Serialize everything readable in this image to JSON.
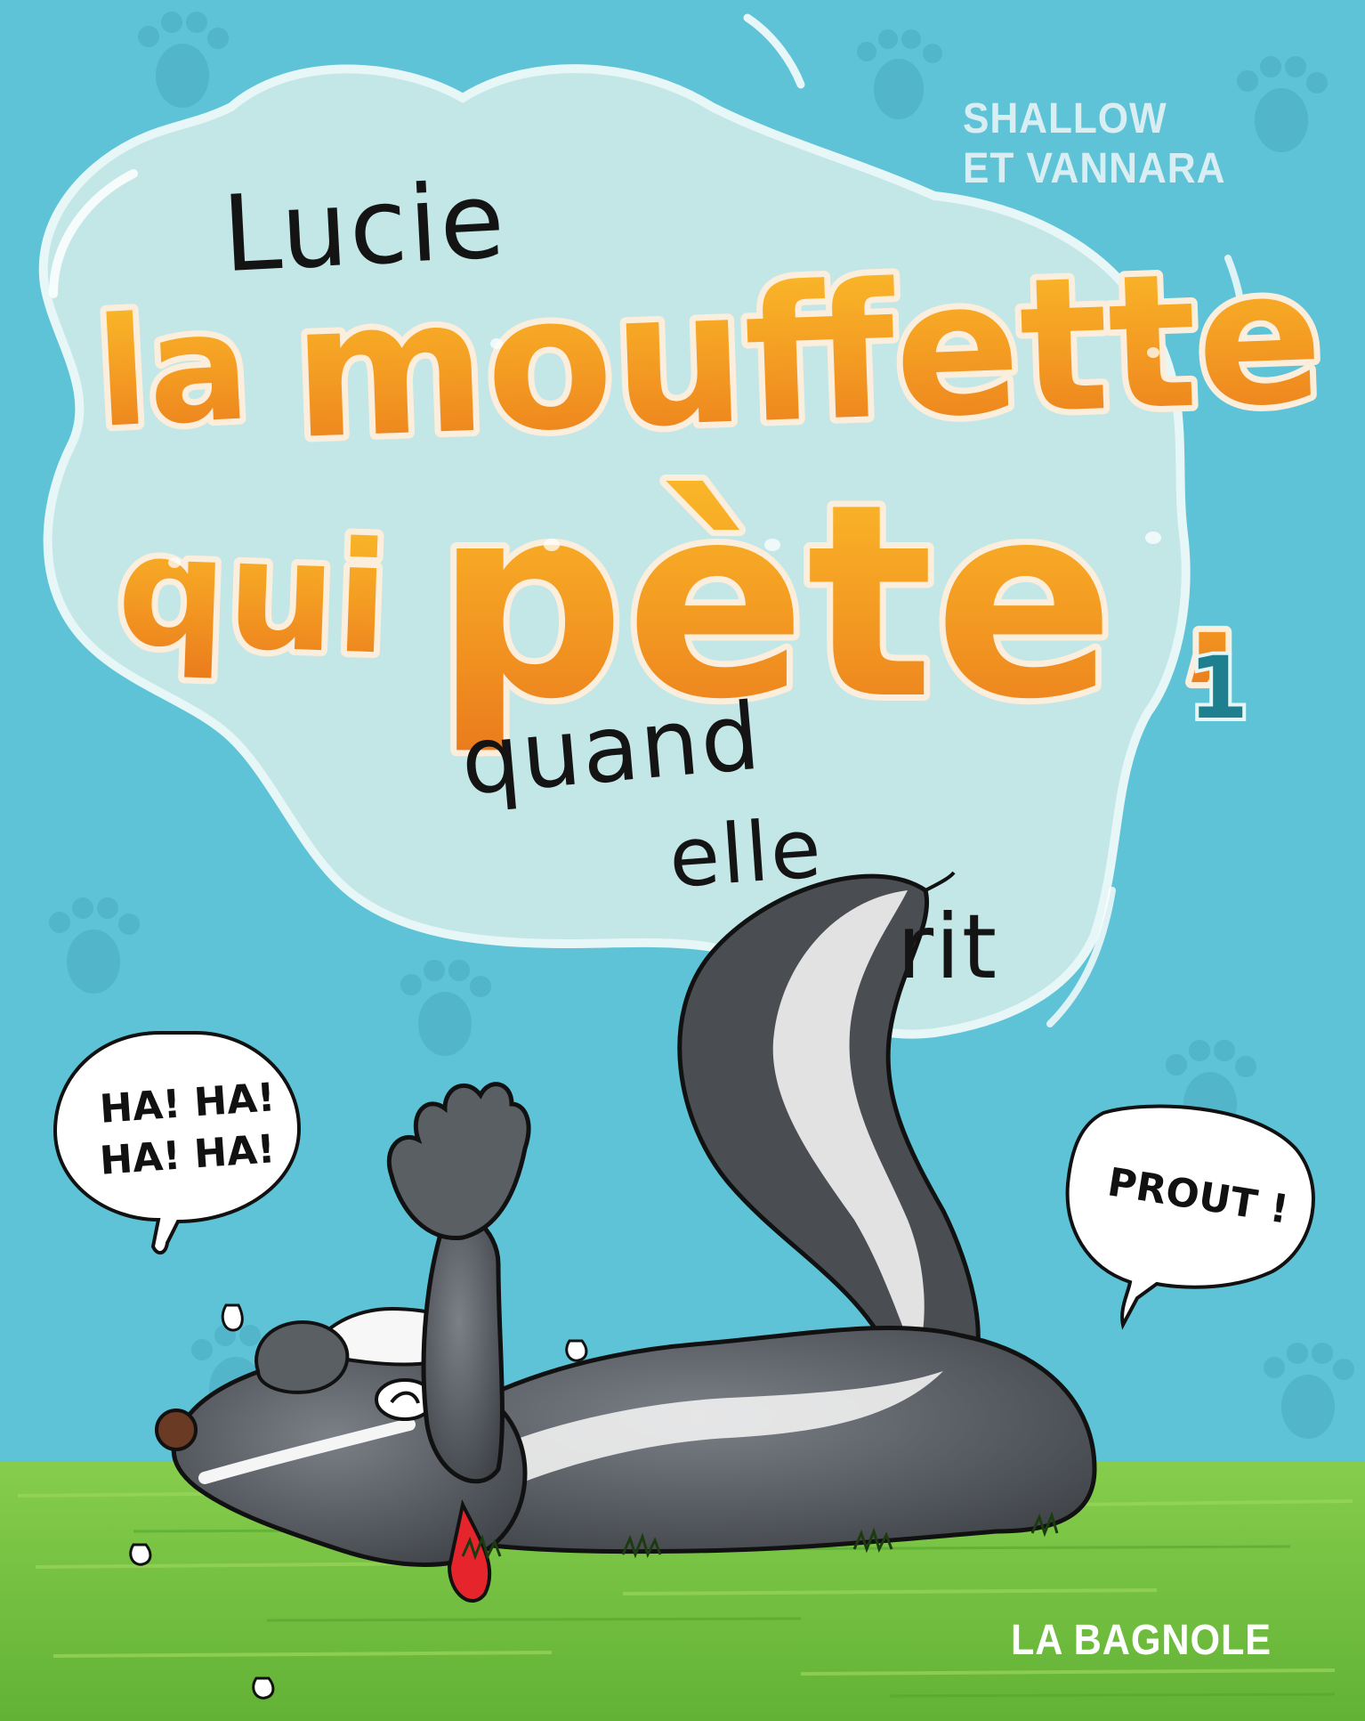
{
  "cover": {
    "authors": [
      "SHALLOW",
      "ET VANNARA"
    ],
    "title": {
      "word1": "Lucie",
      "word2": "la",
      "word3": "mouffette",
      "word4": "qui",
      "word5": "pète",
      "comma": ",",
      "volume": "1",
      "word6": "quand",
      "word7": "elle",
      "word8": "rit"
    },
    "bubbles": {
      "left_line1": "HA! HA!",
      "left_line2": "HA! HA!",
      "right": "PROUT !"
    },
    "publisher": "LA BAGNOLE"
  },
  "colors": {
    "background": "#5ec3d6",
    "cloud": "#bfe5e6",
    "title_orange": "#f08a1f",
    "title_yellow": "#fbb726",
    "volume": "#1e7f8e",
    "grass": "#74c043",
    "skunk_body": "#555a60"
  }
}
